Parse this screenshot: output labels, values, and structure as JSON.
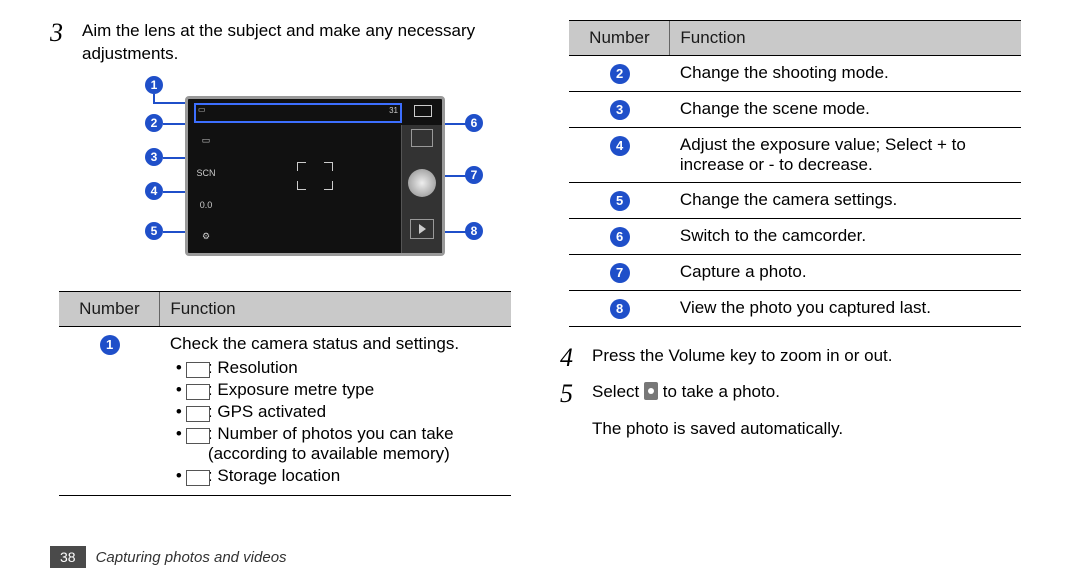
{
  "steps": {
    "s3": {
      "num": "3",
      "text": "Aim the lens at the subject and make any necessary adjustments."
    },
    "s4": {
      "num": "4",
      "text": "Press the Volume key to zoom in or out."
    },
    "s5": {
      "num": "5",
      "text_a": "Select",
      "text_b": "to take a photo.",
      "sub": "The photo is saved automatically."
    }
  },
  "table_headers": {
    "number": "Number",
    "function": "Function"
  },
  "left_table": {
    "row1": {
      "num": "1",
      "lead": "Check the camera status and settings.",
      "b1": ": Resolution",
      "b2": ": Exposure metre type",
      "b3": ": GPS activated",
      "b4": ": Number of photos you can take (according to available memory)",
      "b5": ": Storage location"
    }
  },
  "right_table": {
    "r2": "Change the shooting mode.",
    "r3": "Change the scene mode.",
    "r4": "Adjust the exposure value; Select + to increase or - to decrease.",
    "r5": "Change the camera settings.",
    "r6": "Switch to the camcorder.",
    "r7": "Capture a photo.",
    "r8": "View the photo you captured last."
  },
  "right_nums": {
    "n2": "2",
    "n3": "3",
    "n4": "4",
    "n5": "5",
    "n6": "6",
    "n7": "7",
    "n8": "8"
  },
  "diagram": {
    "c1": "1",
    "c2": "2",
    "c3": "3",
    "c4": "4",
    "c5": "5",
    "c6": "6",
    "c7": "7",
    "c8": "8",
    "scn": "SCN",
    "ev": "0.0",
    "cnt": "31"
  },
  "footer": {
    "page": "38",
    "section": "Capturing photos and videos"
  }
}
